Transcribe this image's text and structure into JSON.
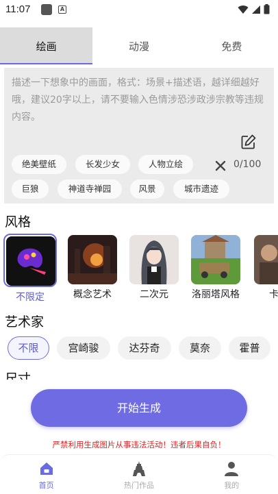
{
  "status_bar": {
    "time": "11:07",
    "app_badge": "A"
  },
  "tabs": [
    {
      "label": "绘画",
      "active": true
    },
    {
      "label": "动漫",
      "active": false
    },
    {
      "label": "免费",
      "active": false
    }
  ],
  "prompt": {
    "placeholder": "描述一下想象中的画面，格式：场景+描述语，越详细越好哦，建议20字以上，请不要输入色情涉恐涉政涉宗教等违规内容。",
    "char_count": "0/100",
    "chips": [
      "绝美壁纸",
      "长发少女",
      "人物立绘",
      "巨狼",
      "神道寺禅园",
      "风景",
      "城市遗迹"
    ]
  },
  "style_section": {
    "title": "风格",
    "items": [
      {
        "label": "不限定",
        "selected": true
      },
      {
        "label": "概念艺术",
        "selected": false
      },
      {
        "label": "二次元",
        "selected": false
      },
      {
        "label": "洛丽塔风格",
        "selected": false
      },
      {
        "label": "卡通",
        "selected": false
      }
    ]
  },
  "artist_section": {
    "title": "艺术家",
    "items": [
      {
        "label": "不限",
        "selected": true
      },
      {
        "label": "宫崎骏",
        "selected": false
      },
      {
        "label": "达芬奇",
        "selected": false
      },
      {
        "label": "莫奈",
        "selected": false
      },
      {
        "label": "霍普",
        "selected": false
      }
    ]
  },
  "size_section": {
    "title": "尺寸"
  },
  "generate_button": {
    "label": "开始生成"
  },
  "warning": "严禁利用生成图片从事违法活动！违者后果自负！",
  "bottom_nav": [
    {
      "label": "首页",
      "icon": "home-icon",
      "active": true
    },
    {
      "label": "热门作品",
      "icon": "tower-icon",
      "active": false
    },
    {
      "label": "我的",
      "icon": "person-icon",
      "active": false
    }
  ],
  "colors": {
    "accent": "#6f6ce3",
    "warning": "#e02020",
    "panel": "#ebebeb"
  }
}
